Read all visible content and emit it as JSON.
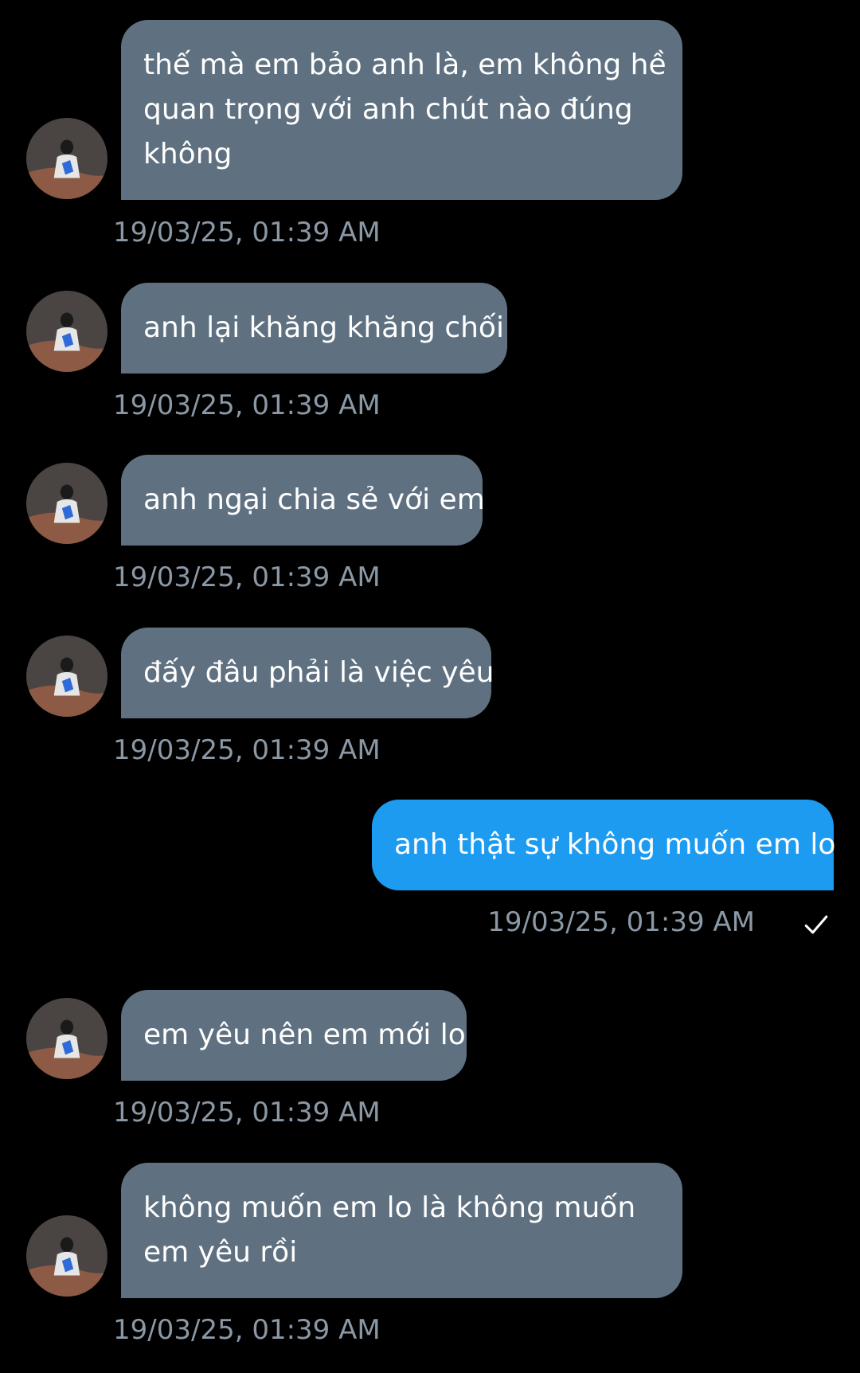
{
  "conversation": {
    "messages": [
      {
        "sender": "other",
        "lines": [
          "thế mà em bảo anh là, em không hề",
          "quan trọng với anh chút nào đúng",
          "không"
        ],
        "timestamp": "19/03/25, 01:39 AM"
      },
      {
        "sender": "other",
        "lines": [
          "anh lại khăng khăng chối"
        ],
        "timestamp": "19/03/25, 01:39 AM"
      },
      {
        "sender": "other",
        "lines": [
          "anh ngại chia sẻ với em"
        ],
        "timestamp": "19/03/25, 01:39 AM"
      },
      {
        "sender": "other",
        "lines": [
          "đấy đâu phải là việc yêu"
        ],
        "timestamp": "19/03/25, 01:39 AM"
      },
      {
        "sender": "me",
        "lines": [
          "anh thật sự không muốn em lo"
        ],
        "timestamp": "19/03/25, 01:39 AM",
        "status_icon": "checkmark-icon"
      },
      {
        "sender": "other",
        "lines": [
          "em yêu nên em mới lo"
        ],
        "timestamp": "19/03/25, 01:39 AM"
      },
      {
        "sender": "other",
        "lines": [
          "không muốn em lo là không muốn",
          "em yêu rồi"
        ],
        "timestamp": "19/03/25, 01:39 AM"
      }
    ]
  },
  "colors": {
    "background": "#000000",
    "incoming_bubble": "#5f7181",
    "outgoing_bubble": "#1d9bf0",
    "timestamp_text": "#8b98a5",
    "message_text": "#ffffff"
  }
}
